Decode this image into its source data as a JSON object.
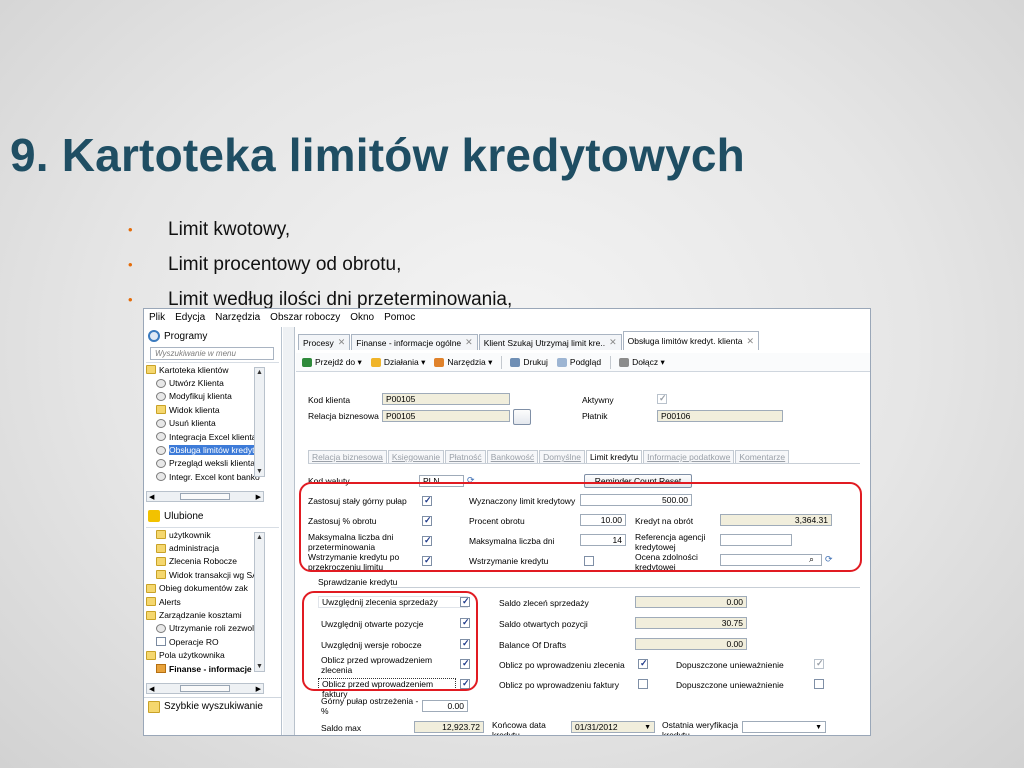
{
  "slide": {
    "title": "9. Kartoteka limitów kredytowych",
    "bullets": [
      "Limit kwotowy,",
      "Limit procentowy od obrotu,",
      "Limit według ilości dni przeterminowania,"
    ]
  },
  "menu": [
    "Plik",
    "Edycja",
    "Narzędzia",
    "Obszar roboczy",
    "Okno",
    "Pomoc"
  ],
  "left": {
    "programs_title": "Programy",
    "search_placeholder": "Wyszukiwanie w menu",
    "programs": [
      "Kartoteka klientów",
      "Utwórz Klienta",
      "Modyfikuj klienta",
      "Widok klienta",
      "Usuń klienta",
      "Integracja Excel klienta",
      "Obsługa limitów kredyt.",
      "Przegląd weksli klienta",
      "Integr. Excel kont banko"
    ],
    "favorites_title": "Ulubione",
    "favorites": [
      "użytkownik",
      "administracja",
      "Zlecenia Robocze",
      "Widok transakcji wg SA",
      "Obieg dokumentów zak",
      "Alerts",
      "Zarządzanie kosztami",
      "Utrzymanie roli zezwole",
      "Operacje RO",
      "Pola użytkownika",
      "Finanse - informacje"
    ],
    "quick_search": "Szybkie wyszukiwanie"
  },
  "tabs": [
    "Procesy",
    "Finanse - informacje ogólne",
    "Klient Szukaj Utrzymaj limit kre..",
    "Obsługa limitów kredyt. klienta"
  ],
  "toolbar": [
    "Przejdź do",
    "Działania",
    "Narzędzia",
    "Drukuj",
    "Podgląd",
    "Dołącz"
  ],
  "form": {
    "kod_klienta_label": "Kod klienta",
    "kod_klienta": "P00105",
    "relacja_label": "Relacja biznesowa",
    "relacja": "P00105",
    "aktywny_label": "Aktywny",
    "platnik_label": "Płatnik",
    "platnik": "P00106",
    "subtabs": [
      "Relacja biznesowa",
      "Księgowanie",
      "Płatność",
      "Bankowość",
      "Domyślne",
      "Limit kredytu",
      "Informacje podatkowe",
      "Komentarze"
    ],
    "kod_waluty_label": "Kod waluty",
    "kod_waluty": "PLN",
    "reminder_button": "Reminder Count Reset",
    "zastosuj_staly_label": "Zastosuj stały górny pułap",
    "wyznaczony_label": "Wyznaczony limit kredytowy",
    "wyznaczony": "500.00",
    "zastosuj_proc_label": "Zastosuj % obrotu",
    "procent_label": "Procent obrotu",
    "procent": "10.00",
    "kredyt_obrot_label": "Kredyt na obrót",
    "kredyt_obrot": "3,364.31",
    "max_dni_label": "Maksymalna liczba dni przeterminowania",
    "max_liczba_label": "Maksymalna liczba dni",
    "max_liczba": "14",
    "referencja_label": "Referencja agencji kredytowej",
    "wstrzymanie_po_label": "Wstrzymanie kredytu po przekroczeniu limitu",
    "wstrzymanie_label": "Wstrzymanie kredytu",
    "ocena_label": "Ocena zdolności kredytowej",
    "group_title": "Sprawdzanie kredytu",
    "uwz_zlecenia_label": "Uwzględnij zlecenia sprzedaży",
    "saldo_zlecen_label": "Saldo zleceń sprzedaży",
    "saldo_zlecen": "0.00",
    "uwz_otwarte_label": "Uwzględnij otwarte pozycje",
    "saldo_otwartych_label": "Saldo otwartych pozycji",
    "saldo_otwartych": "30.75",
    "uwz_wersje_label": "Uwzględnij wersje robocze",
    "balance_drafts_label": "Balance Of Drafts",
    "balance_drafts": "0.00",
    "oblicz_przed_zlecenia_label": "Oblicz przed wprowadzeniem zlecenia",
    "oblicz_po_zlecenia_label": "Oblicz po wprowadzeniu zlecenia",
    "dopuszczone1_label": "Dopuszczone unieważnienie",
    "oblicz_przed_faktury_label": "Oblicz przed wprowadzeniem faktury",
    "oblicz_po_faktury_label": "Oblicz po wprowadzeniu faktury",
    "dopuszczone2_label": "Dopuszczone unieważnienie",
    "gorny_pulap_label": "Górny pułap ostrzeżenia - %",
    "gorny_pulap": "0.00",
    "saldo_max_label": "Saldo max",
    "saldo_max": "12,923.72",
    "koncowa_data_label": "Końcowa data kredytu",
    "koncowa_data": "01/31/2012",
    "ostatnia_label": "Ostatnia weryfikacja kredytu"
  },
  "colors": {
    "title": "#1f4e63",
    "bullet": "#e46c0a",
    "highlight": "#e11b22",
    "selected": "#3d7bd8"
  }
}
